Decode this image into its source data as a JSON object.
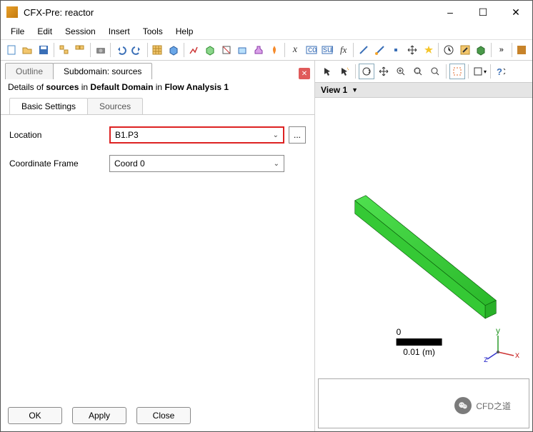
{
  "window": {
    "title": "CFX-Pre:  reactor",
    "min_icon": "–",
    "max_icon": "☐",
    "close_icon": "✕"
  },
  "menu": [
    "File",
    "Edit",
    "Session",
    "Insert",
    "Tools",
    "Help"
  ],
  "toolbar_overflow": "»",
  "left": {
    "tabs": {
      "outline": "Outline",
      "subdomain": "Subdomain: sources"
    },
    "details_prefix": "Details of ",
    "details_name": "sources",
    "details_mid": " in ",
    "details_domain": "Default Domain",
    "details_mid2": " in ",
    "details_analysis": "Flow Analysis 1",
    "subtabs": {
      "basic": "Basic Settings",
      "sources": "Sources"
    },
    "form": {
      "location_label": "Location",
      "location_value": "B1.P3",
      "coord_label": "Coordinate Frame",
      "coord_value": "Coord 0",
      "dots": "..."
    },
    "buttons": {
      "ok": "OK",
      "apply": "Apply",
      "close": "Close"
    }
  },
  "right": {
    "view_label": "View 1",
    "view_chev": "▼",
    "scale_zero": "0",
    "scale_value": "0.01",
    "scale_unit": "(m)",
    "triad": {
      "x": "x",
      "y": "y",
      "z": "z"
    },
    "help_icon": "?"
  },
  "watermark": {
    "text": "CFD之道"
  }
}
